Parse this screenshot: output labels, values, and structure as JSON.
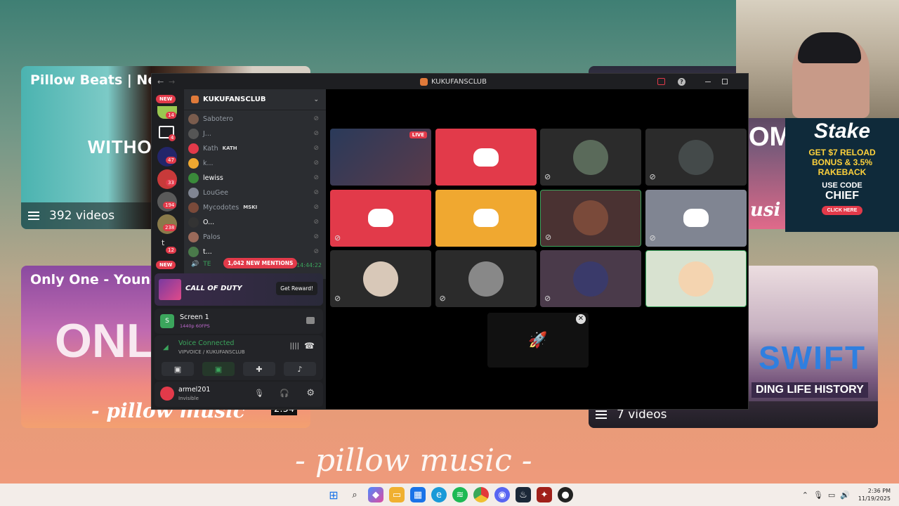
{
  "background": {
    "cards": [
      {
        "title": "Pillow Beats | New",
        "overlay": "WITHO",
        "count": "392 videos"
      },
      {
        "title": "Only One - Young",
        "overlay": "ONL",
        "script": "- pillow music",
        "duration": "2:54"
      },
      {
        "overlay": "OM",
        "script": "usi"
      },
      {
        "overlay": "SWIFT",
        "subtitle": "DING LIFE HISTORY",
        "count": "7 videos"
      }
    ],
    "footer_script": "- pillow music -",
    "stake_ad": {
      "brand": "Stake",
      "line1": "GET $7 RELOAD",
      "line2": "BONUS & 3.5%",
      "line3": "RAKEBACK",
      "line4": "USE CODE",
      "code": "CHIEF",
      "cta": "CLICK HERE"
    }
  },
  "discord": {
    "window_title": "KUKUFANSCLUB",
    "server_name": "KUKUFANSCLUB",
    "server_badges": [
      "NEW",
      "14",
      "4",
      "47",
      "33",
      "194",
      "238",
      "12",
      "NEW"
    ],
    "members": [
      {
        "name": "Sabotero",
        "color": "#7a5c4d"
      },
      {
        "name": "J...",
        "color": "#555"
      },
      {
        "name": "Kath",
        "tag": "KATH",
        "color": "#e23a4a"
      },
      {
        "name": "k...",
        "color": "#f0a830"
      },
      {
        "name": "lewiss",
        "color": "#3a8a3a"
      },
      {
        "name": "LouGee",
        "color": "#808592"
      },
      {
        "name": "Mycodotes",
        "tag": "MSKI",
        "color": "#7a4a3a"
      },
      {
        "name": "O...",
        "color": "#333"
      },
      {
        "name": "Palos",
        "color": "#9a6a5a"
      },
      {
        "name": "t...",
        "color": "#4a7a4a"
      }
    ],
    "voice_channel_prefix": "TE",
    "mentions_pill": "1,042 NEW MENTIONS",
    "timestamp": "14:44:22",
    "promo": {
      "game": "CALL OF DUTY",
      "cta": "Get Reward!"
    },
    "stream": {
      "title": "Screen 1",
      "quality": "1440p 60FPS"
    },
    "voice": {
      "status": "Voice Connected",
      "channel": "VIPVOICE / KUKUFANSCLUB"
    },
    "user": {
      "name": "armel201",
      "status": "Invisible"
    },
    "live_badge": "LIVE",
    "tile_colors": [
      "#000",
      "#e23a4a",
      "#2b2b2b",
      "#2b2b2b",
      "#e23a4a",
      "#f0a830",
      "#4a3232",
      "#808592",
      "#2b2b2b",
      "#2b2b2b",
      "#4a3a4a",
      "#d8e2d0"
    ]
  },
  "taskbar": {
    "time": "2:36 PM",
    "date": "11/19/2025"
  }
}
